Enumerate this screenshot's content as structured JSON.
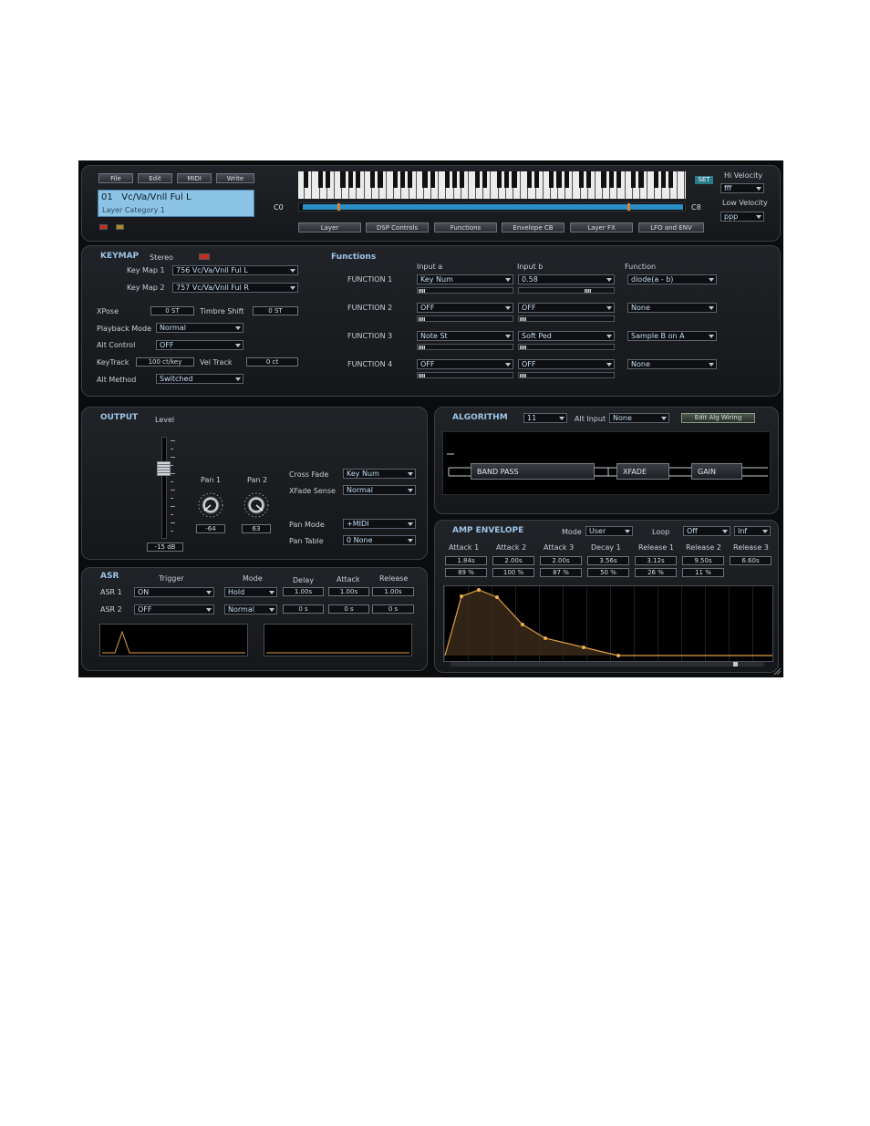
{
  "menu": {
    "file": "File",
    "edit": "Edit",
    "midi": "MIDI",
    "write": "Write"
  },
  "program": {
    "name": "01   Vc/Va/Vnll Ful L",
    "category": "Layer Category 1"
  },
  "keyboard": {
    "low_key": "C0",
    "high_key": "C8",
    "set_label": "SET"
  },
  "velocity": {
    "hi_label": "Hi Velocity",
    "hi_value": "fff",
    "low_label": "Low Velocity",
    "low_value": "ppp"
  },
  "tabs": [
    "Layer",
    "DSP Controls",
    "Functions",
    "Envelope CB",
    "Layer FX",
    "LFO and ENV"
  ],
  "keymap": {
    "title": "KEYMAP",
    "stereo_label": "Stereo",
    "keymap1_label": "Key Map 1",
    "keymap1_value": "756 Vc/Va/Vnll Ful L",
    "keymap2_label": "Key Map 2",
    "keymap2_value": "757 Vc/Va/Vnll Ful R",
    "xpose_label": "XPose",
    "xpose_value": "0 ST",
    "timbre_label": "Timbre Shift",
    "timbre_value": "0 ST",
    "playback_label": "Playback Mode",
    "playback_value": "Normal",
    "altcontrol_label": "Alt Control",
    "altcontrol_value": "OFF",
    "keytrack_label": "KeyTrack",
    "keytrack_value": "100 ct/key",
    "veltrack_label": "Vel Track",
    "veltrack_value": "0 ct",
    "altmethod_label": "Alt Method",
    "altmethod_value": "Switched"
  },
  "functions": {
    "title": "Functions",
    "input_a_label": "Input a",
    "input_b_label": "Input b",
    "function_label": "Function",
    "rows": [
      {
        "label": "FUNCTION 1",
        "a": "Key Num",
        "b": "0.58",
        "f": "diode(a - b)"
      },
      {
        "label": "FUNCTION 2",
        "a": "OFF",
        "b": "OFF",
        "f": "None"
      },
      {
        "label": "FUNCTION 3",
        "a": "Note St",
        "b": "Soft Ped",
        "f": "Sample B on A"
      },
      {
        "label": "FUNCTION 4",
        "a": "OFF",
        "b": "OFF",
        "f": "None"
      }
    ]
  },
  "output": {
    "title": "OUTPUT",
    "level_label": "Level",
    "level_value": "-15 dB",
    "pan1_label": "Pan 1",
    "pan1_value": "-64",
    "pan2_label": "Pan 2",
    "pan2_value": "63",
    "crossfade_label": "Cross Fade",
    "crossfade_value": "Key Num",
    "xfadesense_label": "XFade Sense",
    "xfadesense_value": "Normal",
    "panmode_label": "Pan Mode",
    "panmode_value": "+MIDI",
    "pantable_label": "Pan Table",
    "pantable_value": "0 None"
  },
  "algorithm": {
    "title": "ALGORITHM",
    "value": "11",
    "altinput_label": "Alt Input",
    "altinput_value": "None",
    "edit_label": "Edit Alg Wiring",
    "blocks": [
      "BAND PASS",
      "XFADE",
      "GAIN"
    ]
  },
  "asr": {
    "title": "ASR",
    "trigger_label": "Trigger",
    "mode_label": "Mode",
    "delay_label": "Delay",
    "attack_label": "Attack",
    "release_label": "Release",
    "rows": [
      {
        "label": "ASR 1",
        "trigger": "ON",
        "mode": "Hold",
        "delay": "1.00s",
        "attack": "1.00s",
        "release": "1.00s"
      },
      {
        "label": "ASR 2",
        "trigger": "OFF",
        "mode": "Normal",
        "delay": "0 s",
        "attack": "0 s",
        "release": "0 s"
      }
    ]
  },
  "amp": {
    "title": "AMP ENVELOPE",
    "mode_label": "Mode",
    "mode_value": "User",
    "loop_label": "Loop",
    "loop_value": "Off",
    "inf_value": "Inf",
    "stages": [
      {
        "label": "Attack 1",
        "time": "1.84s",
        "level": "89 %"
      },
      {
        "label": "Attack 2",
        "time": "2.00s",
        "level": "100 %"
      },
      {
        "label": "Attack 3",
        "time": "2.00s",
        "level": "87 %"
      },
      {
        "label": "Decay 1",
        "time": "3.56s",
        "level": "50 %"
      },
      {
        "label": "Release 1",
        "time": "3.12s",
        "level": "26 %"
      },
      {
        "label": "Release 2",
        "time": "9.50s",
        "level": "11 %"
      },
      {
        "label": "Release 3",
        "time": "6.60s",
        "level": ""
      }
    ]
  },
  "colors": {
    "accent": "#9fc4e6",
    "lcd": "#8cc4e6",
    "envelope_line": "#e0a040",
    "led_red": "#c03020"
  }
}
